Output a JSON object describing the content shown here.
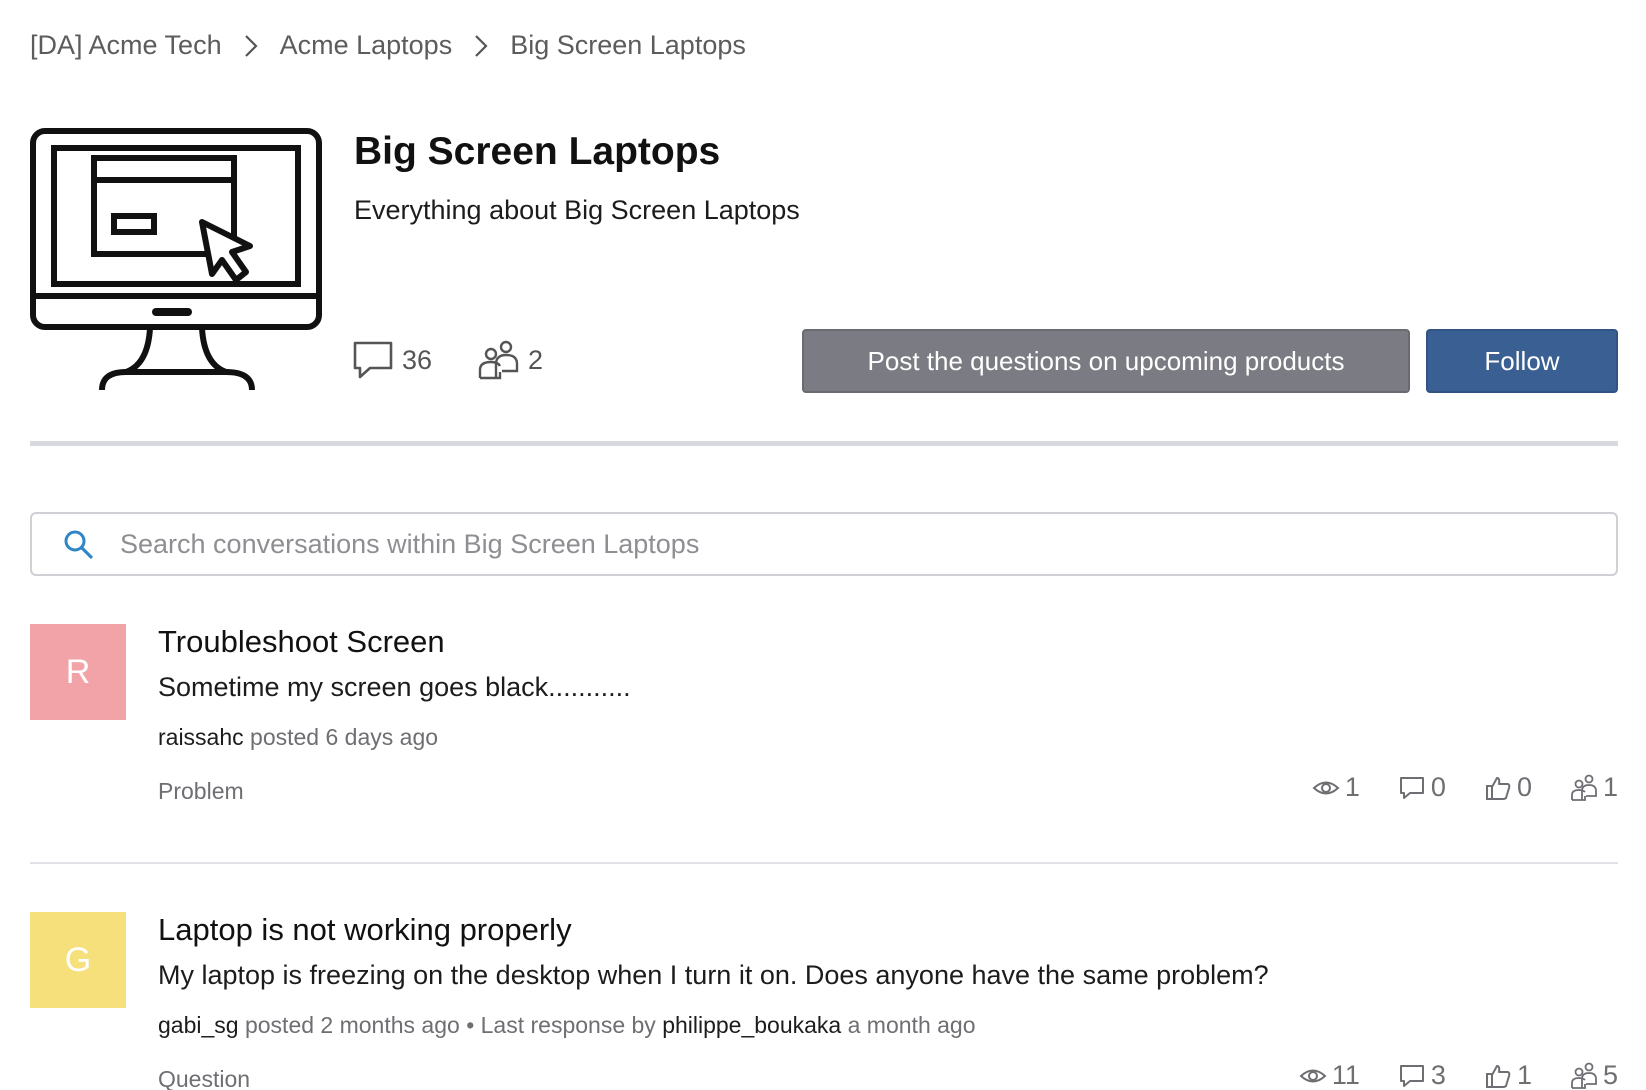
{
  "breadcrumb": {
    "items": [
      "[DA] Acme Tech",
      "Acme Laptops",
      "Big Screen Laptops"
    ]
  },
  "board": {
    "title": "Big Screen Laptops",
    "description": "Everything about Big Screen Laptops",
    "image_icon": "computer-monitor-cursor-icon",
    "conversations_count": "36",
    "followers_count": "2"
  },
  "actions": {
    "post_label": "Post the questions on upcoming products",
    "follow_label": "Follow"
  },
  "search": {
    "placeholder": "Search conversations within Big Screen Laptops"
  },
  "topics": [
    {
      "avatar_letter": "R",
      "avatar_color": "#f2a3a7",
      "title": "Troubleshoot Screen",
      "snippet": "Sometime my screen goes black...........",
      "author": "raissahc",
      "posted_text": "posted 6 days ago",
      "last_response_prefix": "",
      "last_responder": "",
      "last_response_time": "",
      "type": "Problem",
      "views": "1",
      "replies": "0",
      "likes": "0",
      "followers": "1"
    },
    {
      "avatar_letter": "G",
      "avatar_color": "#f5e07c",
      "title": "Laptop is not working properly",
      "snippet": "My laptop is freezing on the desktop when I turn it on. Does anyone have the same problem?",
      "author": "gabi_sg",
      "posted_text": "posted 2 months ago",
      "last_response_prefix": "• Last response by",
      "last_responder": "philippe_boukaka",
      "last_response_time": "a month ago",
      "type": "Question",
      "views": "11",
      "replies": "3",
      "likes": "1",
      "followers": "5"
    }
  ],
  "colors": {
    "follow_button": "#3a5f93",
    "post_button": "#7b7c83",
    "search_icon": "#2f86c7"
  }
}
